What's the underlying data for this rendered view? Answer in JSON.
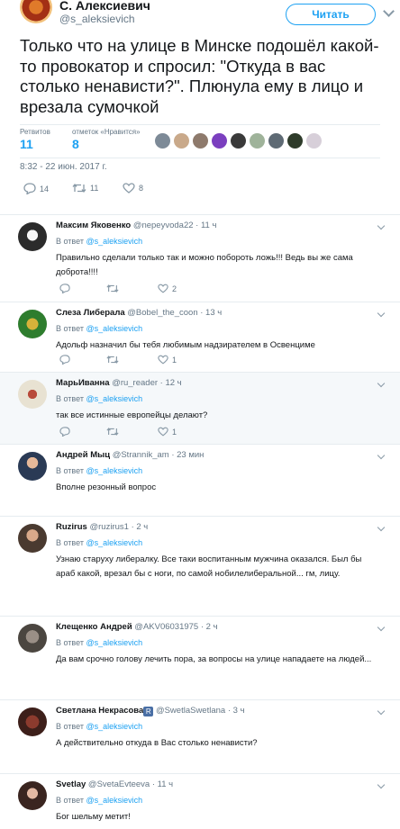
{
  "tweet": {
    "author_name": "С. Алексиевич",
    "author_handle": "@s_aleksievich",
    "follow_label": "Читать",
    "text": "Только что на улице в Минске подошёл какой-то провокатор и спросил: \"Откуда в вас столько ненависти?\". Плюнула ему в лицо и врезала сумочкой",
    "retweets_label": "Ретвитов",
    "retweets_count": "11",
    "likes_label": "отметок «Нравится»",
    "likes_count": "8",
    "timestamp": "8:32 - 22 июн. 2017 г.",
    "actions": {
      "replies": "14",
      "retweets": "11",
      "likes": "8"
    }
  },
  "replies": [
    {
      "name": "Максим Яковенко",
      "handle": "@nepeyvoda22",
      "time": "· 11 ч",
      "in_reply_label": "В ответ",
      "in_reply_handle": "@s_aleksievich",
      "text": "Правильно сделали только так и можно побороть ложь!!! Ведь вы же сама доброта!!!!",
      "likes": "2"
    },
    {
      "name": "Слеза Либерала",
      "handle": "@Bobel_the_coon",
      "time": "· 13 ч",
      "in_reply_label": "В ответ",
      "in_reply_handle": "@s_aleksievich",
      "text": "Адольф назначил бы тебя любимым надзирателем в Освенциме",
      "likes": "1"
    },
    {
      "name": "МарьИванна",
      "handle": "@ru_reader",
      "time": "· 12 ч",
      "in_reply_label": "В ответ",
      "in_reply_handle": "@s_aleksievich",
      "text": "так все истинные европейцы делают?",
      "likes": "1"
    },
    {
      "name": "Андрей Мыц",
      "handle": "@Strannik_am",
      "time": "· 23 мин",
      "in_reply_label": "В ответ",
      "in_reply_handle": "@s_aleksievich",
      "text": "Вполне резонный вопрос",
      "likes": ""
    },
    {
      "name": "Ruzirus",
      "handle": "@ruzirus1",
      "time": "· 2 ч",
      "in_reply_label": "В ответ",
      "in_reply_handle": "@s_aleksievich",
      "text": "Узнаю старуху либералку. Все таки воспитанным мужчина оказался. Был бы араб какой, врезал бы с ноги, по самой нобилелиберальной... гм, лицу.",
      "likes": ""
    },
    {
      "name": "Клещенко Андрей",
      "handle": "@AKV06031975",
      "time": "· 2 ч",
      "in_reply_label": "В ответ",
      "in_reply_handle": "@s_aleksievich",
      "text": "Да вам срочно голову лечить пора, за вопросы на улице нападаете на людей...",
      "likes": ""
    },
    {
      "name": "Светлана Некрасова",
      "handle": "@SwetlaSwetlana",
      "time": "· 3 ч",
      "in_reply_label": "В ответ",
      "in_reply_handle": "@s_aleksievich",
      "text": "А действительно откуда в Вас столько ненависти?",
      "likes": "",
      "badge": "R"
    },
    {
      "name": "Svetlay",
      "handle": "@SvetaEvteeva",
      "time": "· 11 ч",
      "in_reply_label": "В ответ",
      "in_reply_handle": "@s_aleksievich",
      "text": "Бог шельму метит!",
      "likes": ""
    }
  ],
  "colors": {
    "accent": "#1da1f2",
    "muted": "#657786",
    "border": "#e6ecf0",
    "highlight": "#f5f8fa"
  },
  "icons": [
    "reply-icon",
    "retweet-icon",
    "like-icon",
    "chevron-down-icon",
    "verified-badge"
  ]
}
